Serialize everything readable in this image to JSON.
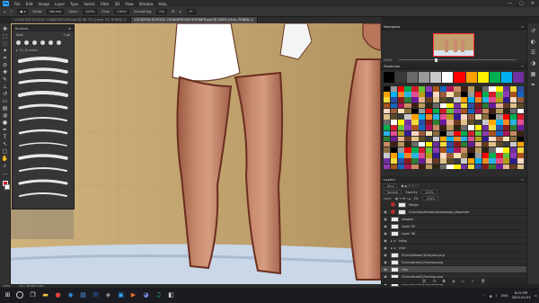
{
  "menubar": {
    "app_badge": "Ps",
    "items": [
      "File",
      "Edit",
      "Image",
      "Layer",
      "Type",
      "Select",
      "Filter",
      "3D",
      "View",
      "Window",
      "Help"
    ],
    "window_buttons": [
      "—",
      "▢",
      "✕"
    ]
  },
  "options": {
    "mode_label": "Mode:",
    "mode_value": "Normal",
    "opacity_label": "Opac:",
    "opacity_value": "100%",
    "flow_label": "Flow:",
    "flow_value": "100%",
    "smoothing_label": "Smoothing:",
    "smoothing_value": "0%",
    "angle_value": "0°"
  },
  "tabs": [
    {
      "label": "LOCATION SCHOOL CHANGEROOM.psd @ 66.7% (Layer 43, RGB/8) ×",
      "active": false
    },
    {
      "label": "LOCATION SCHOOL CHANGEROOM SHOWER.psd @ 200% (char, RGB/8) ×",
      "active": true
    }
  ],
  "brush_panel": {
    "title": "Brushes",
    "size_label": "Size:",
    "size_value": "7 px",
    "folder_label": "▸ 1G_Brushes"
  },
  "navigator": {
    "title": "Navigator",
    "zoom": "200%"
  },
  "swatches": {
    "title": "Swatches",
    "colors": [
      "#000000",
      "#3a3a3a",
      "#6a6a6a",
      "#9a9a9a",
      "#c9c9c9",
      "#ffffff",
      "#ff0000",
      "#ffa200",
      "#fff200",
      "#00b050",
      "#00b0f0",
      "#7030a0",
      "#d21d2b",
      "#f08a24",
      "#f4dc3c",
      "#66c23a",
      "#2ab3e5",
      "#2a4fa5",
      "#8e3bb0",
      "#e14d8f",
      "#8b1a1a",
      "#a9541b",
      "#b39f19",
      "#2e7d32",
      "#1565c0",
      "#311b92",
      "#6a1b9a",
      "#ad1457",
      "#ffd7c2",
      "#e8b48f",
      "#c98a63",
      "#9a5b3a",
      "#6b3a22",
      "#3e2012",
      "#f7e1b5",
      "#e0c28a",
      "#b9985e",
      "#8a6e3e",
      "#5c4a28",
      "#2f2514"
    ]
  },
  "layers": {
    "title": "Layers",
    "filter_label": "Kind",
    "blend_mode": "Normal",
    "opacity_label": "Opacity:",
    "opacity_value": "100%",
    "lock_label": "Lock:",
    "fill_label": "Fill:",
    "fill_value": "100%",
    "rows": [
      {
        "name": "Merge",
        "visible": false,
        "has_thumb": true,
        "selected": false
      },
      {
        "name": "01/school/shower/props/soap_dispenser",
        "visible": true,
        "has_thumb": true,
        "selected": false
      },
      {
        "name": "shadow",
        "visible": true,
        "has_thumb": true,
        "selected": false
      },
      {
        "name": "Layer 39",
        "visible": true,
        "has_thumb": true,
        "selected": false
      },
      {
        "name": "Layer 38",
        "visible": true,
        "has_thumb": true,
        "selected": false
      },
      {
        "name": "fx/bg",
        "visible": true,
        "has_thumb": false,
        "selected": false
      },
      {
        "name": "char",
        "visible": true,
        "has_thumb": false,
        "selected": false
      },
      {
        "name": "01/cmd/down/1/hey/sss.png",
        "visible": true,
        "has_thumb": true,
        "selected": false
      },
      {
        "name": "01/cmd/cmd/1/hey/sss.png",
        "visible": true,
        "has_thumb": true,
        "selected": false
      },
      {
        "name": "char",
        "visible": true,
        "has_thumb": true,
        "selected": true
      },
      {
        "name": "01/cmd/cmd/1/hey/sss.png",
        "visible": true,
        "has_thumb": true,
        "selected": false
      },
      {
        "name": "01/cmd/cmd/1/hey/sss.png",
        "visible": true,
        "has_thumb": true,
        "selected": false
      },
      {
        "name": "01/cmd/cmd/1/hey/sss.png",
        "visible": true,
        "has_thumb": true,
        "selected": false
      }
    ]
  },
  "status": {
    "zoom": "200%",
    "doc": "Doc: 88.8M/1.26G"
  },
  "taskbar": {
    "clock_time": "8:01 PM",
    "clock_date": "2023-03-03",
    "lang": "ENG"
  }
}
